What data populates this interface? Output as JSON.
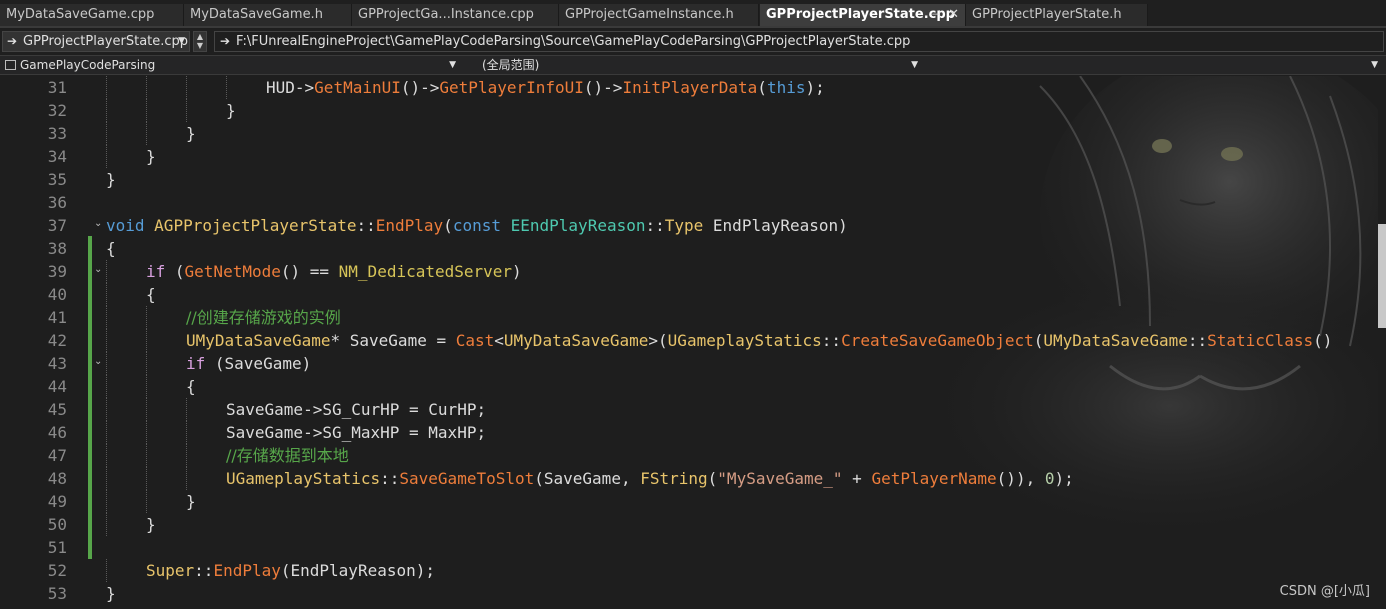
{
  "tabs": [
    {
      "label": "MyDataSaveGame.cpp"
    },
    {
      "label": "MyDataSaveGame.h"
    },
    {
      "label": "GPProjectGa...Instance.cpp"
    },
    {
      "label": "GPProjectGameInstance.h"
    },
    {
      "label": "GPProjectPlayerState.cpp",
      "active": true
    },
    {
      "label": "GPProjectPlayerState.h"
    }
  ],
  "tab_icons": {
    "pin": "pin-icon",
    "close": "close-icon"
  },
  "nav": {
    "file_combo": "GPProjectPlayerState.cpp",
    "path": "F:\\FUnrealEngineProject\\GamePlayCodeParsing\\Source\\GamePlayCodeParsing\\GPProjectPlayerState.cpp"
  },
  "scope": {
    "project": "GamePlayCodeParsing",
    "scope": "(全局范围)",
    "member": ""
  },
  "colors": {
    "keyword": "#569cd6",
    "control": "#d8a0df",
    "type": "#4ec9b0",
    "class": "#e8c46b",
    "function": "#ee7d3b",
    "macro": "#d6c458",
    "comment": "#57a64a",
    "string": "#d69d85",
    "number": "#b5cea8",
    "plain": "#dcdcdc",
    "change_bar": "#57a64a"
  },
  "editor": {
    "lines": [
      {
        "n": 31,
        "indent": 4,
        "tokens": [
          [
            "HUD",
            "plain"
          ],
          [
            "->",
            "plain"
          ],
          [
            "GetMainUI",
            "function"
          ],
          [
            "()->",
            "plain"
          ],
          [
            "GetPlayerInfoUI",
            "function"
          ],
          [
            "()->",
            "plain"
          ],
          [
            "InitPlayerData",
            "function"
          ],
          [
            "(",
            "plain"
          ],
          [
            "this",
            "keyword"
          ],
          [
            ");",
            "plain"
          ]
        ]
      },
      {
        "n": 32,
        "indent": 3,
        "tokens": [
          [
            "}",
            "plain"
          ]
        ]
      },
      {
        "n": 33,
        "indent": 2,
        "tokens": [
          [
            "}",
            "plain"
          ]
        ]
      },
      {
        "n": 34,
        "indent": 1,
        "tokens": [
          [
            "}",
            "plain"
          ]
        ]
      },
      {
        "n": 35,
        "indent": 0,
        "tokens": [
          [
            "}",
            "plain"
          ]
        ]
      },
      {
        "n": 36,
        "indent": 0,
        "tokens": []
      },
      {
        "n": 37,
        "indent": 0,
        "tokens": [
          [
            "void",
            "keyword"
          ],
          [
            " ",
            "plain"
          ],
          [
            "AGPProjectPlayerState",
            "class"
          ],
          [
            "::",
            "plain"
          ],
          [
            "EndPlay",
            "function"
          ],
          [
            "(",
            "plain"
          ],
          [
            "const",
            "keyword"
          ],
          [
            " ",
            "plain"
          ],
          [
            "EEndPlayReason",
            "type"
          ],
          [
            "::",
            "plain"
          ],
          [
            "Type",
            "class"
          ],
          [
            " EndPlayReason)",
            "plain"
          ]
        ]
      },
      {
        "n": 38,
        "indent": 0,
        "tokens": [
          [
            "{",
            "plain"
          ]
        ]
      },
      {
        "n": 39,
        "indent": 1,
        "tokens": [
          [
            "if",
            "control"
          ],
          [
            " (",
            "plain"
          ],
          [
            "GetNetMode",
            "function"
          ],
          [
            "() == ",
            "plain"
          ],
          [
            "NM_DedicatedServer",
            "macro"
          ],
          [
            ")",
            "plain"
          ]
        ]
      },
      {
        "n": 40,
        "indent": 1,
        "tokens": [
          [
            "{",
            "plain"
          ]
        ]
      },
      {
        "n": 41,
        "indent": 2,
        "tokens": [
          [
            "//创建存储游戏的实例",
            "comment"
          ]
        ]
      },
      {
        "n": 42,
        "indent": 2,
        "tokens": [
          [
            "UMyDataSaveGame",
            "class"
          ],
          [
            "* SaveGame = ",
            "plain"
          ],
          [
            "Cast",
            "function"
          ],
          [
            "<",
            "plain"
          ],
          [
            "UMyDataSaveGame",
            "class"
          ],
          [
            ">(",
            "plain"
          ],
          [
            "UGameplayStatics",
            "class"
          ],
          [
            "::",
            "plain"
          ],
          [
            "CreateSaveGameObject",
            "function"
          ],
          [
            "(",
            "plain"
          ],
          [
            "UMyDataSaveGame",
            "class"
          ],
          [
            "::",
            "plain"
          ],
          [
            "StaticClass",
            "function"
          ],
          [
            "()",
            "plain"
          ]
        ]
      },
      {
        "n": 43,
        "indent": 2,
        "tokens": [
          [
            "if",
            "control"
          ],
          [
            " (SaveGame)",
            "plain"
          ]
        ]
      },
      {
        "n": 44,
        "indent": 2,
        "tokens": [
          [
            "{",
            "plain"
          ]
        ]
      },
      {
        "n": 45,
        "indent": 3,
        "tokens": [
          [
            "SaveGame->SG_CurHP = CurHP;",
            "plain"
          ]
        ]
      },
      {
        "n": 46,
        "indent": 3,
        "tokens": [
          [
            "SaveGame->SG_MaxHP = MaxHP;",
            "plain"
          ]
        ]
      },
      {
        "n": 47,
        "indent": 3,
        "tokens": [
          [
            "//存储数据到本地",
            "comment"
          ]
        ]
      },
      {
        "n": 48,
        "indent": 3,
        "tokens": [
          [
            "UGameplayStatics",
            "class"
          ],
          [
            "::",
            "plain"
          ],
          [
            "SaveGameToSlot",
            "function"
          ],
          [
            "(SaveGame, ",
            "plain"
          ],
          [
            "FString",
            "class"
          ],
          [
            "(",
            "plain"
          ],
          [
            "\"MySaveGame_\"",
            "string"
          ],
          [
            " + ",
            "plain"
          ],
          [
            "GetPlayerName",
            "function"
          ],
          [
            "()), ",
            "plain"
          ],
          [
            "0",
            "number"
          ],
          [
            ");",
            "plain"
          ]
        ]
      },
      {
        "n": 49,
        "indent": 2,
        "tokens": [
          [
            "}",
            "plain"
          ]
        ]
      },
      {
        "n": 50,
        "indent": 1,
        "tokens": [
          [
            "}",
            "plain"
          ]
        ]
      },
      {
        "n": 51,
        "indent": 0,
        "tokens": []
      },
      {
        "n": 52,
        "indent": 1,
        "tokens": [
          [
            "Super",
            "class"
          ],
          [
            "::",
            "plain"
          ],
          [
            "EndPlay",
            "function"
          ],
          [
            "(EndPlayReason);",
            "plain"
          ]
        ]
      },
      {
        "n": 53,
        "indent": 0,
        "tokens": [
          [
            "}",
            "plain"
          ]
        ]
      }
    ],
    "fold_markers": [
      {
        "line": 37,
        "glyph": "⌄"
      },
      {
        "line": 39,
        "glyph": "⌄"
      },
      {
        "line": 43,
        "glyph": "⌄"
      }
    ]
  },
  "watermark": "CSDN @[小瓜]"
}
